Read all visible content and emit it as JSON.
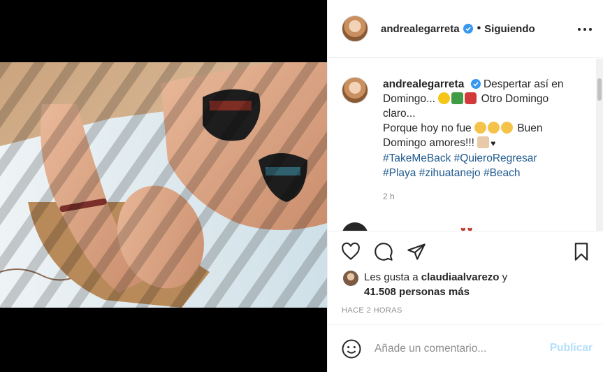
{
  "post": {
    "username": "andrealegarreta",
    "separator": "•",
    "follow_status": "Siguiendo",
    "caption": {
      "username": "andrealegarreta",
      "line1": "Despertar así en Domingo...",
      "line1b": "Otro Domingo claro...",
      "line2": "Porque hoy no fue",
      "line2b": "Buen Domingo amores!!!",
      "hashtags": [
        "#TakeMeBack",
        "#QuieroRegresar",
        "#Playa",
        "#zihuatanejo",
        "#Beach"
      ]
    },
    "time": "2 h",
    "likes": {
      "prefix": "Les gusta a",
      "liker": "claudiaalvarezo",
      "joiner": "y",
      "count": "41.508 personas más"
    },
    "posted_ago": "HACE 2 HORAS",
    "comment_placeholder": "Añade un comentario...",
    "publish_label": "Publicar"
  },
  "colors": {
    "text": "#262626",
    "muted": "#8e8e8e",
    "hashtag": "#1f5a8e",
    "publish_disabled": "#b2dffc",
    "verified": "#3897f0"
  },
  "icons": [
    "verified-badge-icon",
    "more-options-icon",
    "heart-icon",
    "comment-icon",
    "share-icon",
    "save-icon",
    "emoji-icon"
  ]
}
